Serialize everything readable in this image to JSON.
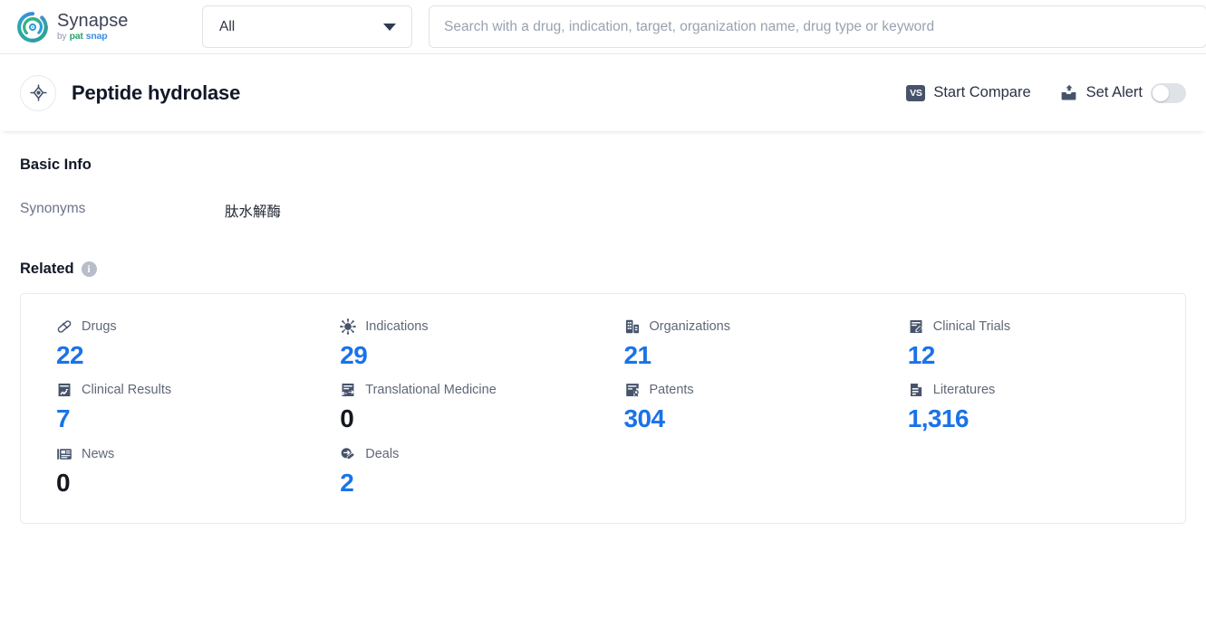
{
  "brand": {
    "name": "Synapse",
    "by": "by",
    "pat": "pat",
    "snap": "snap"
  },
  "search": {
    "scope_value": "All",
    "scope_options": [
      "All"
    ],
    "placeholder": "Search with a drug, indication, target, organization name, drug type or keyword",
    "query": ""
  },
  "entity": {
    "title": "Peptide hydrolase",
    "icon": "target-icon",
    "actions": {
      "compare_label": "Start Compare",
      "compare_badge": "VS",
      "alert_label": "Set Alert",
      "alert_enabled": false
    }
  },
  "basic_info": {
    "heading": "Basic Info",
    "rows": [
      {
        "key": "Synonyms",
        "value": "肽水解酶"
      }
    ]
  },
  "related": {
    "heading": "Related",
    "info_badge": "i",
    "items": [
      {
        "label": "Drugs",
        "value": "22",
        "icon": "pill-icon",
        "link": true
      },
      {
        "label": "Indications",
        "value": "29",
        "icon": "virus-icon",
        "link": true
      },
      {
        "label": "Organizations",
        "value": "21",
        "icon": "building-icon",
        "link": true
      },
      {
        "label": "Clinical Trials",
        "value": "12",
        "icon": "document-pen-icon",
        "link": true
      },
      {
        "label": "Clinical Results",
        "value": "7",
        "icon": "document-chart-icon",
        "link": true
      },
      {
        "label": "Translational Medicine",
        "value": "0",
        "icon": "document-exchange-icon",
        "link": false
      },
      {
        "label": "Patents",
        "value": "304",
        "icon": "document-seal-icon",
        "link": true
      },
      {
        "label": "Literatures",
        "value": "1,316",
        "icon": "document-lines-icon",
        "link": true
      },
      {
        "label": "News",
        "value": "0",
        "icon": "newspaper-icon",
        "link": false
      },
      {
        "label": "Deals",
        "value": "2",
        "icon": "deal-handshake-icon",
        "link": true
      }
    ]
  },
  "colors": {
    "link_blue": "#1a73e8",
    "icon_slate": "#4a5568",
    "text_dark": "#111827",
    "text_muted": "#6b7488",
    "brand_green": "#2aa86a",
    "brand_blue": "#3a8ee6"
  }
}
